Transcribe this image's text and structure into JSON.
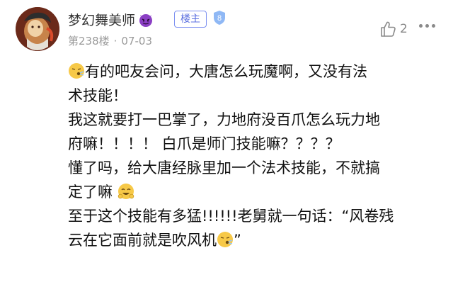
{
  "author": {
    "name": "梦幻舞美师",
    "host_badge": "楼主",
    "level": "8"
  },
  "meta": {
    "floor": "第238楼",
    "separator": "·",
    "date": "07-03"
  },
  "like_count": "2",
  "content": {
    "line1": "有的吧友会问，大唐怎么玩魔啊，又没有法",
    "line2": "术技能！",
    "line3": "我这就要打一巴掌了，力地府没百爪怎么玩力地",
    "line4": "府嘛！！！！ 白爪是师门技能嘛？？？？",
    "line5": "懂了吗，给大唐经脉里加一个法术技能，不就搞",
    "line6": "定了嘛",
    "line7": "至于这个技能有多猛!!!!!!老舅就一句话：“风卷残",
    "line8": "云在它面前就是吹风机",
    "line8_end": "”"
  },
  "icons": {
    "avatar": "avatar-image",
    "devil": "devil-emoji",
    "level": "level-shield-icon",
    "like": "thumbs-up-icon",
    "more": "more-dots-icon",
    "blow": "blowing-face-emoji",
    "happy": "happy-face-emoji"
  },
  "colors": {
    "badge": "#5b6fe0",
    "meta": "#9a9a9a",
    "text": "#111111"
  }
}
